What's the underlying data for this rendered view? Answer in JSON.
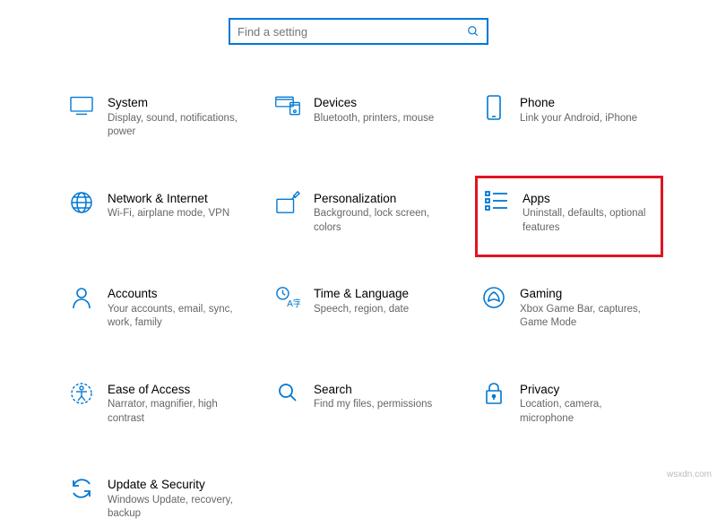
{
  "search": {
    "placeholder": "Find a setting"
  },
  "tiles": {
    "system": {
      "title": "System",
      "desc": "Display, sound, notifications, power"
    },
    "devices": {
      "title": "Devices",
      "desc": "Bluetooth, printers, mouse"
    },
    "phone": {
      "title": "Phone",
      "desc": "Link your Android, iPhone"
    },
    "network": {
      "title": "Network & Internet",
      "desc": "Wi-Fi, airplane mode, VPN"
    },
    "personal": {
      "title": "Personalization",
      "desc": "Background, lock screen, colors"
    },
    "apps": {
      "title": "Apps",
      "desc": "Uninstall, defaults, optional features"
    },
    "accounts": {
      "title": "Accounts",
      "desc": "Your accounts, email, sync, work, family"
    },
    "time": {
      "title": "Time & Language",
      "desc": "Speech, region, date"
    },
    "gaming": {
      "title": "Gaming",
      "desc": "Xbox Game Bar, captures, Game Mode"
    },
    "ease": {
      "title": "Ease of Access",
      "desc": "Narrator, magnifier, high contrast"
    },
    "searchTile": {
      "title": "Search",
      "desc": "Find my files, permissions"
    },
    "privacy": {
      "title": "Privacy",
      "desc": "Location, camera, microphone"
    },
    "update": {
      "title": "Update & Security",
      "desc": "Windows Update, recovery, backup"
    }
  },
  "watermark": "wsxdn.com"
}
